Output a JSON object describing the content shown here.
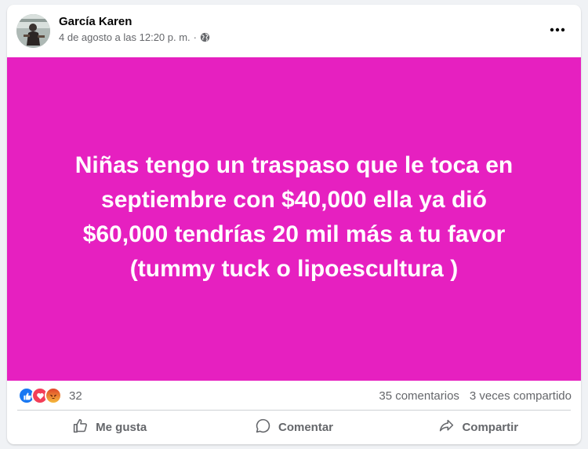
{
  "post": {
    "author": "García Karen",
    "timestamp": "4 de agosto a las 12:20 p. m.",
    "separator": "·",
    "audience_icon": "globe-icon",
    "more_icon": "more-options-icon",
    "background_color": "#e620c0",
    "text_lines": [
      "Niñas tengo un traspaso que le toca en",
      "septiembre con $40,000 ella ya dió",
      "$60,000 tendrías 20 mil más a tu favor",
      "(tummy tuck o lipoescultura )"
    ]
  },
  "reactions": {
    "types": [
      "like-reaction-icon",
      "love-reaction-icon",
      "angry-reaction-icon"
    ],
    "count": "32",
    "comments": "35 comentarios",
    "shares": "3 veces compartido"
  },
  "actions": {
    "like_label": "Me gusta",
    "comment_label": "Comentar",
    "share_label": "Compartir"
  },
  "colors": {
    "like_blue": "#1877f2",
    "love_red": "#f33e58",
    "angry_orange": "#e9710f",
    "secondary_text": "#65676b"
  }
}
